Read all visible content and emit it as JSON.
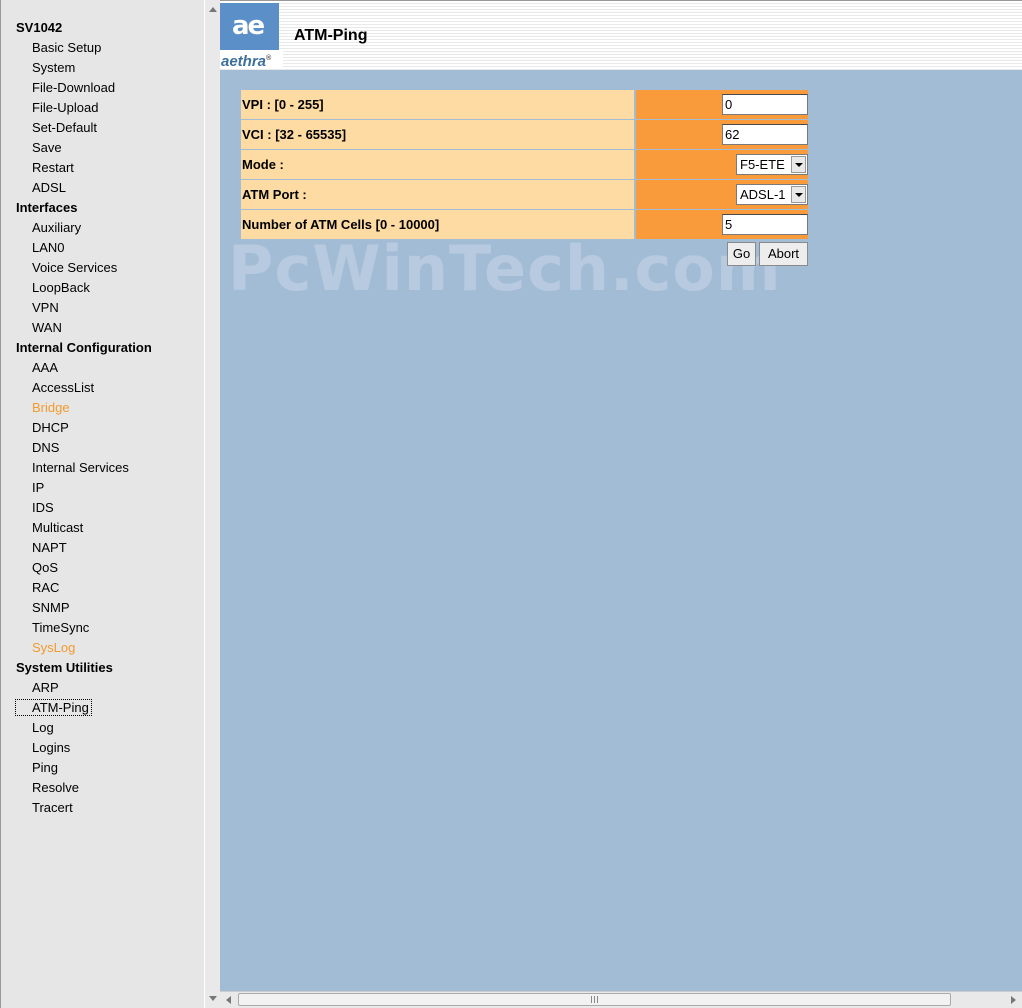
{
  "nav": {
    "device": "SV1042",
    "groups": [
      {
        "name": "SV1042",
        "items": [
          "Basic Setup",
          "System",
          "File-Download",
          "File-Upload",
          "Set-Default",
          "Save",
          "Restart",
          "ADSL"
        ]
      },
      {
        "name": "Interfaces",
        "items": [
          "Auxiliary",
          "LAN0",
          "Voice Services",
          "LoopBack",
          "VPN",
          "WAN"
        ]
      },
      {
        "name": "Internal Configuration",
        "items": [
          "AAA",
          "AccessList",
          "Bridge",
          "DHCP",
          "DNS",
          "Internal Services",
          "IP",
          "IDS",
          "Multicast",
          "NAPT",
          "QoS",
          "RAC",
          "SNMP",
          "TimeSync",
          "SysLog"
        ]
      },
      {
        "name": "System Utilities",
        "items": [
          "ARP",
          "ATM-Ping",
          "Log",
          "Logins",
          "Ping",
          "Resolve",
          "Tracert"
        ]
      }
    ],
    "highlighted": [
      "Bridge",
      "SysLog"
    ],
    "selected": "ATM-Ping",
    "highlight_color": "#f39a2e"
  },
  "header": {
    "logo_mark": "ae",
    "logo_word": "aethra",
    "logo_reg": "®",
    "title": "ATM-Ping"
  },
  "form": {
    "vpi_label": "VPI : [0 - 255]",
    "vpi_value": "0",
    "vci_label": "VCI : [32 - 65535]",
    "vci_value": "62",
    "mode_label": "Mode :",
    "mode_value": "F5-ETE",
    "port_label": "ATM Port :",
    "port_value": "ADSL-1",
    "cells_label": "Number of ATM Cells [0 - 10000]",
    "cells_value": "5",
    "go_label": "Go",
    "abort_label": "Abort"
  },
  "watermark": "PcWinTech.com",
  "colors": {
    "label_bg": "#fddba3",
    "value_bg": "#f99a3b",
    "page_bg": "#a3bcd6",
    "nav_bg": "#e6e6e6"
  }
}
